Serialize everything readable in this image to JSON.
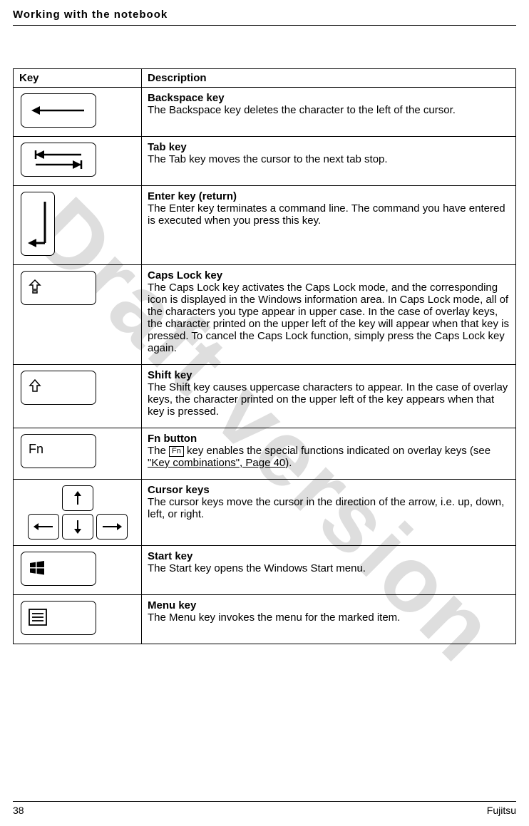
{
  "header": "Working with the notebook",
  "watermark": "Draft version",
  "table": {
    "col_key": "Key",
    "col_desc": "Description"
  },
  "rows": {
    "backspace": {
      "title": "Backspace key",
      "text": "The Backspace key deletes the character to the left of the cursor."
    },
    "tab": {
      "title": "Tab key",
      "text": "The Tab key moves the cursor to the next tab stop."
    },
    "enter": {
      "title": "Enter key (return)",
      "text": "The Enter key terminates a command line. The command you have entered is executed when you press this key."
    },
    "caps": {
      "title": "Caps Lock key",
      "text": "The Caps Lock key activates the Caps Lock mode, and the corresponding icon is displayed in the Windows information area. In Caps Lock mode, all of the characters you type appear in upper case. In the case of overlay keys, the character printed on the upper left of the key will appear when that key is pressed. To cancel the Caps Lock function, simply press the Caps Lock key again."
    },
    "shift": {
      "title": "Shift key",
      "text": "The Shift key causes uppercase characters to appear. In the case of overlay keys, the character printed on the upper left of the key appears when that key is pressed."
    },
    "fn": {
      "title": "Fn button",
      "text_pre": "The ",
      "fn_label": "Fn",
      "text_mid": " key enables the special functions indicated on overlay keys (see ",
      "link_text": "\"Key combinations\", Page 40",
      "text_post": ").",
      "key_label": "Fn"
    },
    "cursor": {
      "title": "Cursor keys",
      "text": "The cursor keys move the cursor in the direction of the arrow, i.e. up, down, left, or right."
    },
    "start": {
      "title": "Start key",
      "text": "The Start key opens the Windows Start menu."
    },
    "menu": {
      "title": "Menu key",
      "text": "The Menu key invokes the menu for the marked item."
    }
  },
  "footer": {
    "page": "38",
    "brand": "Fujitsu"
  }
}
